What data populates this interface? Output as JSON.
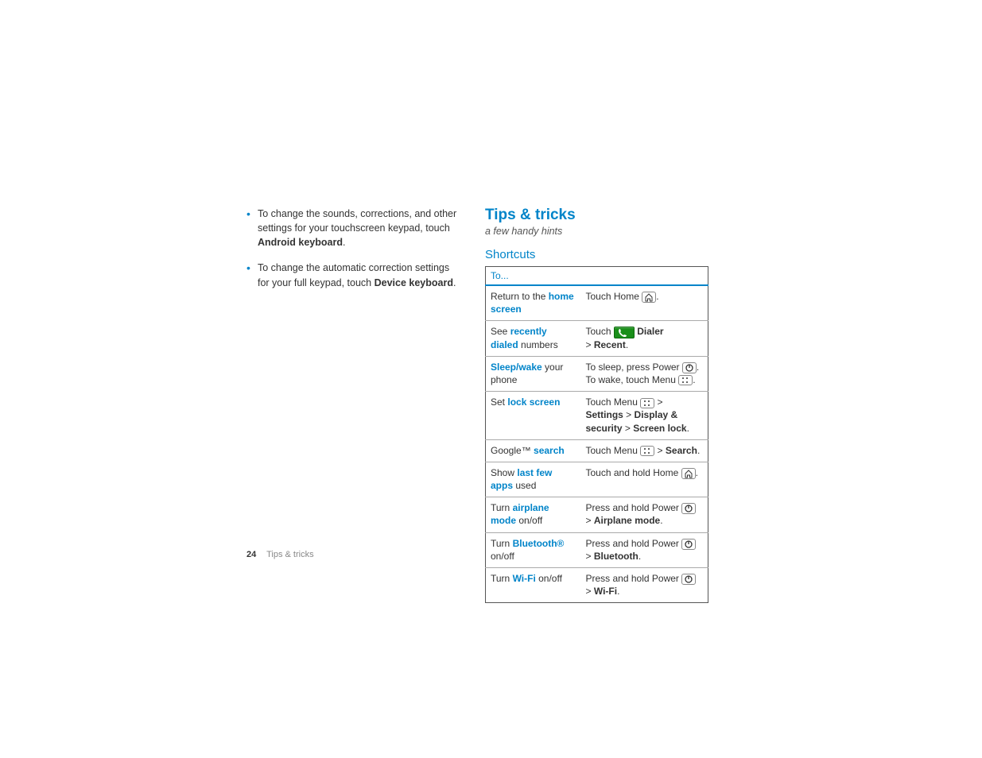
{
  "leftCol": {
    "bullet1": {
      "pre": "To change the sounds, corrections, and other settings for your touchscreen keypad, touch ",
      "bold": "Android keyboard",
      "post": "."
    },
    "bullet2": {
      "pre": "To change the automatic correction settings for your full keypad, touch ",
      "bold": "Device keyboard",
      "post": "."
    }
  },
  "rightCol": {
    "title": "Tips & tricks",
    "subtitle": "a few handy hints",
    "subsection": "Shortcuts",
    "tableHeader": "To...",
    "rows": {
      "r1": {
        "left_pre": "Return to the ",
        "left_link": "home screen",
        "right_pre": "Touch Home ",
        "right_post": "."
      },
      "r2": {
        "left_pre": "See ",
        "left_link": "recently dialed",
        "left_post": " numbers",
        "right_pre": "Touch ",
        "right_bold1": "Dialer",
        "right_mid": " > ",
        "right_bold2": "Recent",
        "right_post": "."
      },
      "r3": {
        "left_link": "Sleep/wake",
        "left_post": " your phone",
        "right_pre": "To sleep, press Power ",
        "right_mid": ". To wake, touch Menu ",
        "right_post": "."
      },
      "r4": {
        "left_pre": "Set ",
        "left_link": "lock screen",
        "right_pre": "Touch Menu ",
        "right_sep1": " > ",
        "right_bold1": "Settings",
        "right_sep2": " > ",
        "right_bold2": "Display & security",
        "right_sep3": " > ",
        "right_bold3": "Screen lock",
        "right_post": "."
      },
      "r5": {
        "left_pre": "Google™ ",
        "left_link": "search",
        "right_pre": "Touch Menu ",
        "right_sep": " > ",
        "right_bold": "Search",
        "right_post": "."
      },
      "r6": {
        "left_pre": "Show ",
        "left_link": "last few apps",
        "left_post": " used",
        "right_pre": "Touch and hold Home ",
        "right_post": "."
      },
      "r7": {
        "left_pre": "Turn ",
        "left_link": "airplane mode",
        "left_post": " on/off",
        "right_pre": "Press and hold Power ",
        "right_sep": " > ",
        "right_bold": "Airplane mode",
        "right_post": "."
      },
      "r8": {
        "left_pre": "Turn ",
        "left_link": "Bluetooth®",
        "left_post": " on/off",
        "right_pre": "Press and hold Power ",
        "right_sep": " > ",
        "right_bold": "Bluetooth",
        "right_post": "."
      },
      "r9": {
        "left_pre": "Turn ",
        "left_link": "Wi-Fi",
        "left_post": " on/off",
        "right_pre": "Press and hold Power ",
        "right_sep": " > ",
        "right_bold": "Wi-Fi",
        "right_post": "."
      }
    }
  },
  "footer": {
    "page": "24",
    "section": "Tips & tricks"
  }
}
